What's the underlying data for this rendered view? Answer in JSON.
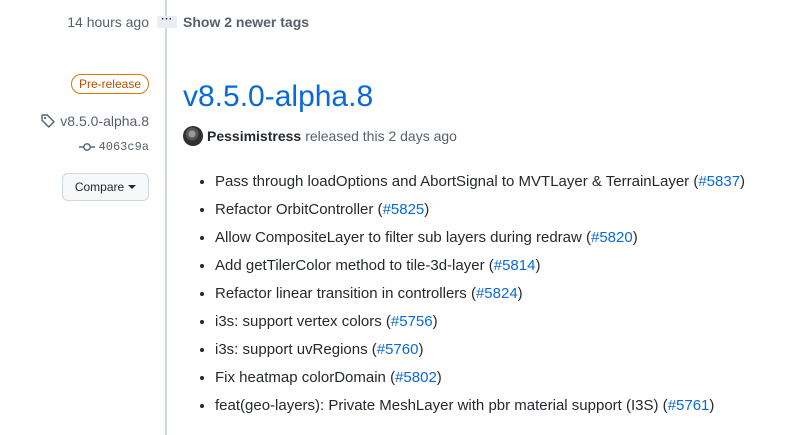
{
  "timeline": {
    "time_ago": "14 hours ago",
    "ellipsis_label": "···",
    "show_newer": "Show 2 newer tags"
  },
  "sidebar": {
    "badge": "Pre-release",
    "tag_name": "v8.5.0-alpha.8",
    "commit": "4063c9a",
    "compare_label": "Compare"
  },
  "release": {
    "title": "v8.5.0-alpha.8",
    "author": "Pessimistress",
    "released_text": "released this 2 days ago",
    "notes": [
      {
        "text": "Pass through loadOptions and AbortSignal to MVTLayer & TerrainLayer (",
        "link": "#5837",
        "suffix": ")"
      },
      {
        "text": "Refactor OrbitController (",
        "link": "#5825",
        "suffix": ")"
      },
      {
        "text": "Allow CompositeLayer to filter sub layers during redraw (",
        "link": "#5820",
        "suffix": ")"
      },
      {
        "text": "Add getTilerColor method to tile-3d-layer (",
        "link": "#5814",
        "suffix": ")"
      },
      {
        "text": "Refactor linear transition in controllers (",
        "link": "#5824",
        "suffix": ")"
      },
      {
        "text": "i3s: support vertex colors (",
        "link": "#5756",
        "suffix": ")"
      },
      {
        "text": "i3s: support uvRegions (",
        "link": "#5760",
        "suffix": ")"
      },
      {
        "text": "Fix heatmap colorDomain (",
        "link": "#5802",
        "suffix": ")"
      },
      {
        "text": "feat(geo-layers): Private MeshLayer with pbr material support (I3S) (",
        "link": "#5761",
        "suffix": ")"
      }
    ]
  },
  "colors": {
    "link": "#0969da",
    "badge_border": "#d97706",
    "badge_text": "#bc4c00",
    "muted": "#57606a"
  },
  "icons": [
    "tag-icon",
    "git-commit-icon",
    "chevron-down-icon",
    "kebab-horizontal-icon"
  ]
}
